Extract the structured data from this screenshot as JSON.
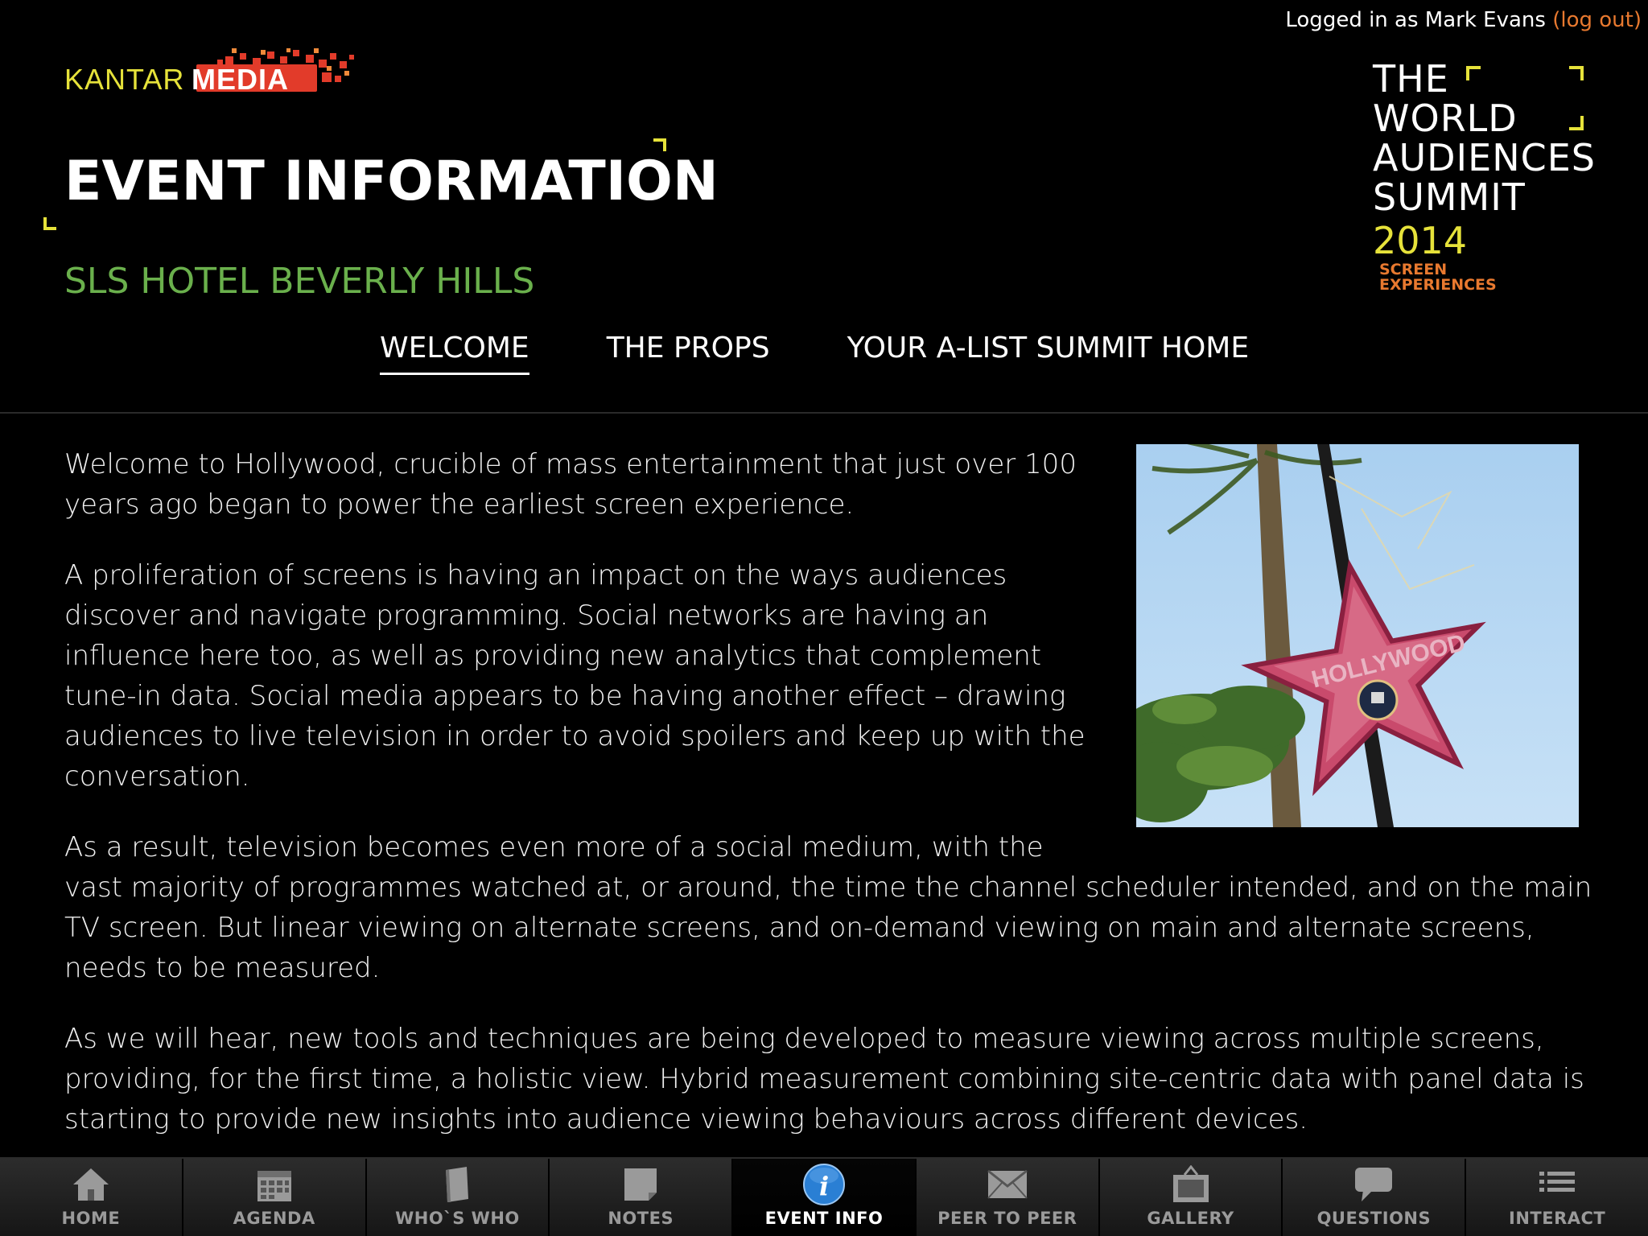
{
  "header": {
    "login_prefix": "Logged in as Mark Evans",
    "logout_label": "(log out)"
  },
  "brand": {
    "kantar": "KANTAR",
    "media": "MEDIA"
  },
  "summit_logo": {
    "line1": "THE",
    "line2": "WORLD",
    "line3": "AUDIENCES",
    "line4": "SUMMIT",
    "year": "2014",
    "sub1": "SCREEN",
    "sub2": "EXPERIENCES"
  },
  "page": {
    "title": "EVENT INFORMATION",
    "venue": "SLS HOTEL BEVERLY HILLS"
  },
  "tabs": [
    {
      "label": "WELCOME",
      "active": true
    },
    {
      "label": "THE PROPS",
      "active": false
    },
    {
      "label": "YOUR A-LIST SUMMIT HOME",
      "active": false
    }
  ],
  "content": {
    "paragraphs": [
      "Welcome to Hollywood, crucible of mass entertainment that just over 100 years ago began to power the earliest screen experience.",
      "A proliferation of screens is having an impact on the ways audiences discover and navigate programming. Social networks are having an influence here too, as well as providing new analytics that complement tune-in data. Social media appears to be having another effect – drawing audiences to live television in order to avoid spoilers and keep up with the conversation.",
      "As a result, television becomes even more of a social medium, with the vast majority of programmes watched at, or around, the time the channel scheduler intended, and on the main TV screen. But linear viewing on alternate screens, and on-demand viewing on main and alternate screens, needs to be measured.",
      "As we will hear, new tools and techniques are being developed to measure viewing across multiple screens, providing, for the first time, a holistic view. Hybrid measurement combining site-centric data with panel data is starting to provide new insights into audience viewing behaviours across different devices."
    ],
    "photo_star_text": "HOLLYWOOD"
  },
  "nav": [
    {
      "label": "HOME",
      "icon": "home-icon",
      "active": false
    },
    {
      "label": "AGENDA",
      "icon": "calendar-icon",
      "active": false
    },
    {
      "label": "WHO`S WHO",
      "icon": "book-icon",
      "active": false
    },
    {
      "label": "NOTES",
      "icon": "notes-icon",
      "active": false
    },
    {
      "label": "EVENT INFO",
      "icon": "info-icon",
      "active": true
    },
    {
      "label": "PEER TO PEER",
      "icon": "envelope-icon",
      "active": false
    },
    {
      "label": "GALLERY",
      "icon": "gallery-icon",
      "active": false
    },
    {
      "label": "QUESTIONS",
      "icon": "speech-bubble-icon",
      "active": false
    },
    {
      "label": "INTERACT",
      "icon": "list-icon",
      "active": false
    }
  ],
  "colors": {
    "accent_yellow": "#e6e23a",
    "accent_orange": "#e8792f",
    "venue_green": "#6ab04c",
    "info_blue": "#2a7fd4"
  }
}
